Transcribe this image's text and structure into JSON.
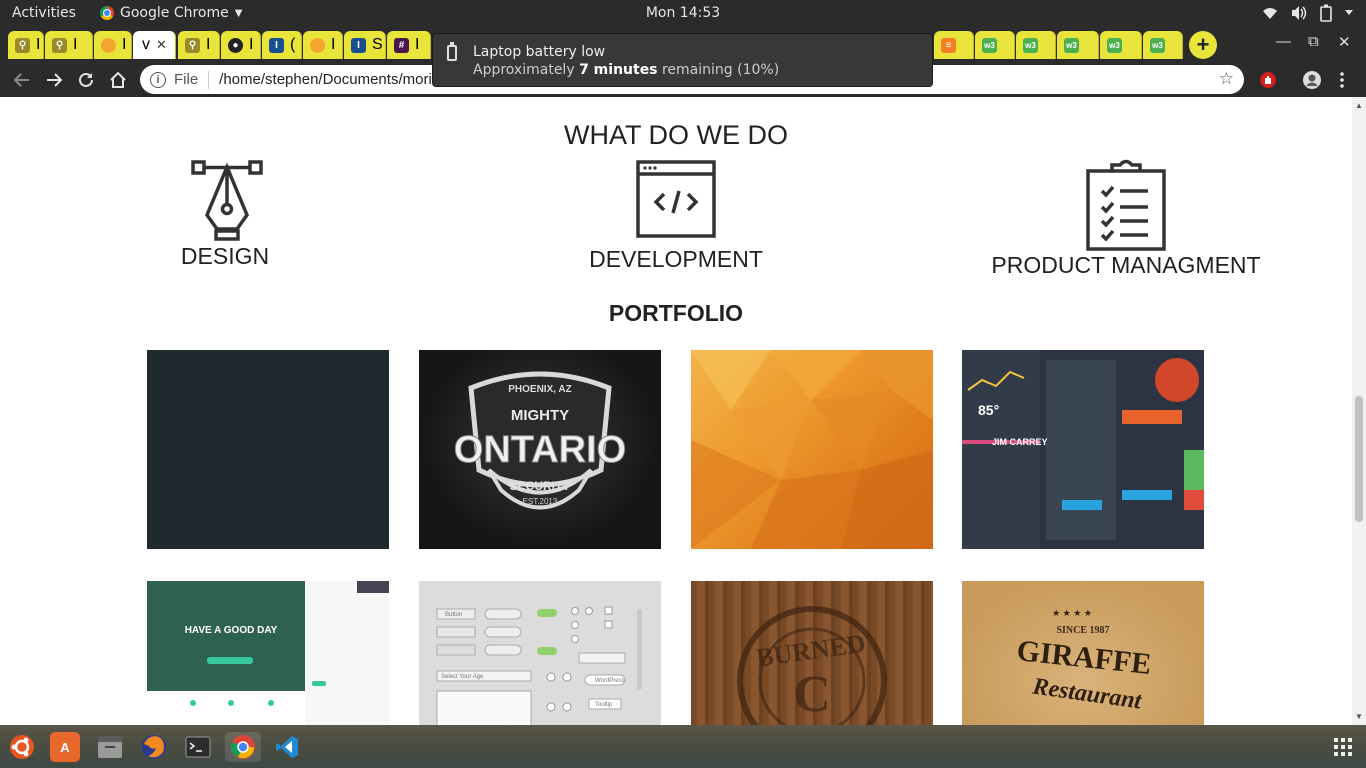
{
  "topbar": {
    "activities": "Activities",
    "app_name": "Google Chrome",
    "clock": "Mon 14:53"
  },
  "browser": {
    "tabs": [
      {
        "icon": "palm-icon",
        "title": "I"
      },
      {
        "icon": "palm-icon",
        "title": "I"
      },
      {
        "icon": "globe-icon",
        "title": "I"
      },
      {
        "icon": "page-icon",
        "title": "v",
        "active": true
      },
      {
        "icon": "palm-icon",
        "title": "I"
      },
      {
        "icon": "github-icon",
        "title": "I"
      },
      {
        "icon": "ibox-icon",
        "title": "("
      },
      {
        "icon": "globe-icon",
        "title": "I"
      },
      {
        "icon": "ibox-icon",
        "title": "S"
      },
      {
        "icon": "slack-icon",
        "title": "I"
      }
    ],
    "address": {
      "scheme": "File",
      "url": "/home/stephen/Documents/morin"
    }
  },
  "notification": {
    "title": "Laptop battery low",
    "body_prefix": "Approximately ",
    "body_bold": "7 minutes",
    "body_suffix": " remaining (10%)"
  },
  "page": {
    "section_title": "WHAT DO WE DO",
    "services": [
      {
        "label": "DESIGN",
        "icon": "pen-tool-icon"
      },
      {
        "label": "DEVELOPMENT",
        "icon": "code-window-icon"
      },
      {
        "label": "PRODUCT MANAGMENT",
        "icon": "clipboard-checklist-icon"
      }
    ],
    "portfolio_title": "PORTFOLIO",
    "portfolio_images": [
      {
        "name": "dark-slate-image"
      },
      {
        "name": "ontario-security-logo-image",
        "text_top": "PHOENIX, AZ",
        "text_mighty": "MIGHTY",
        "text_main": "ONTARIO",
        "text_security": "SECURITY",
        "text_est": "EST.2013"
      },
      {
        "name": "orange-lowpoly-image"
      },
      {
        "name": "dashboard-ui-image",
        "title": "JIM CARREY",
        "temp": "85°"
      },
      {
        "name": "website-template-image",
        "headline": "HAVE A GOOD DAY"
      },
      {
        "name": "ui-kit-image",
        "button": "Button",
        "select": "Select Your Age",
        "wordpress": "WordPress",
        "tooltip": "Tooltip"
      },
      {
        "name": "burned-wood-stamp-image",
        "text": "BURNED"
      },
      {
        "name": "giraffe-restaurant-image",
        "since": "SINCE 1987",
        "brand": "GIRAFFE",
        "sub": "Restaurant"
      }
    ]
  }
}
